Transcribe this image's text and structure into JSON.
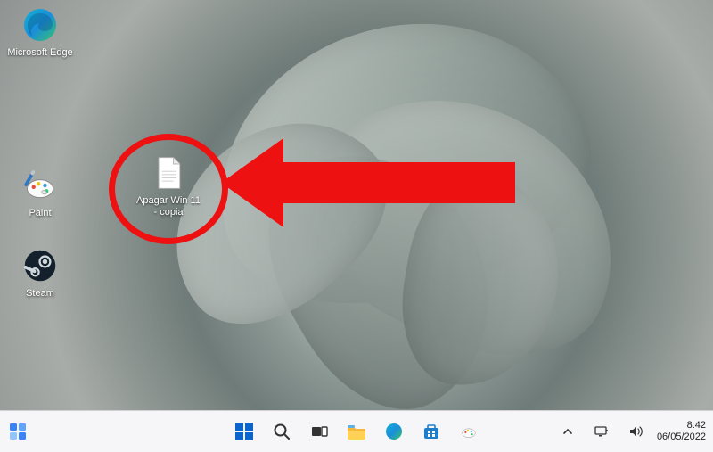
{
  "desktop": {
    "icons": {
      "edge": {
        "label": "Microsoft Edge"
      },
      "paint": {
        "label": "Paint"
      },
      "steam": {
        "label": "Steam"
      },
      "file": {
        "label": "Apagar Win 11 - copia"
      }
    }
  },
  "taskbar": {
    "tray": {
      "time": "8:42",
      "date": "06/05/2022"
    }
  },
  "annotation": {
    "circle_color": "#e11",
    "arrow_color": "#e11"
  }
}
